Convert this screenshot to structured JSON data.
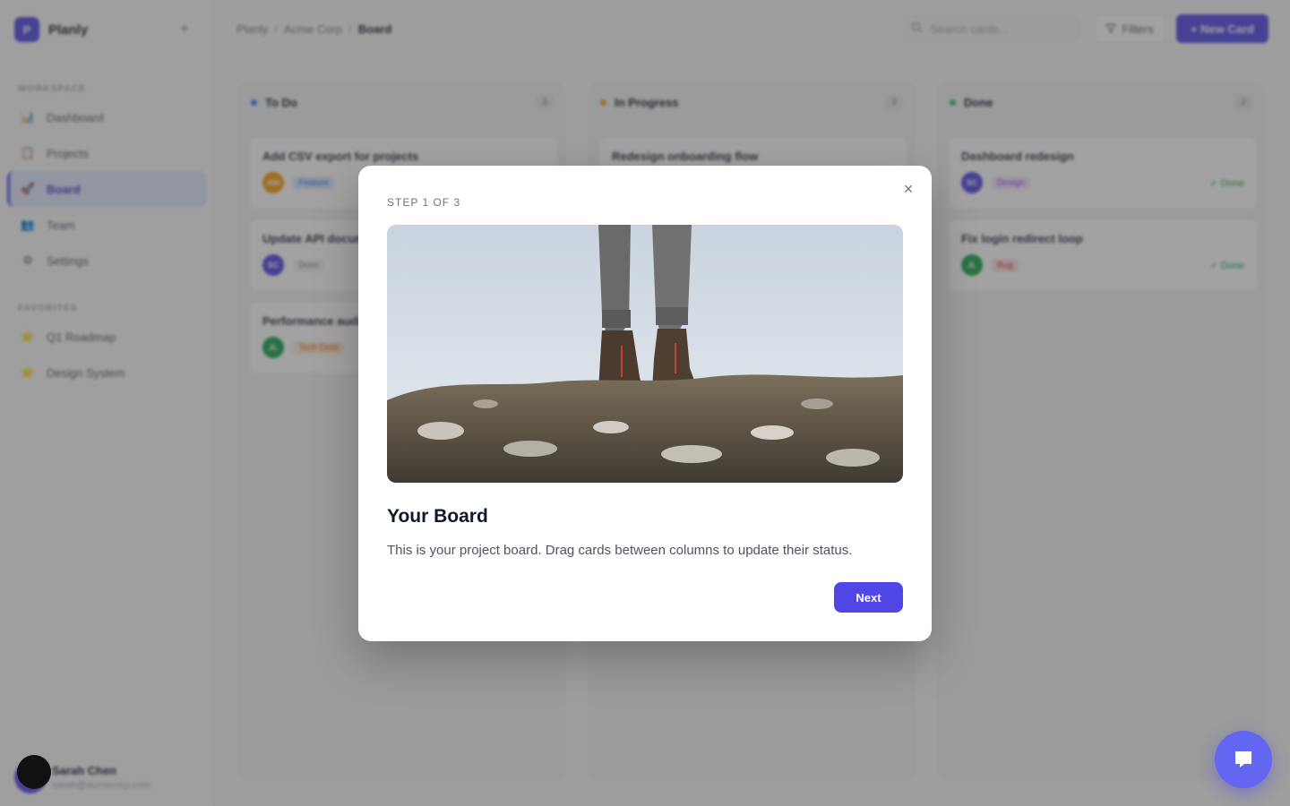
{
  "app": {
    "name": "Planly",
    "logo_letter": "P",
    "add_symbol": "+"
  },
  "sidebar": {
    "workspace_label": "WORKSPACE",
    "favorites_label": "FAVORITES",
    "items": [
      {
        "label": "Dashboard",
        "icon": "📊"
      },
      {
        "label": "Projects",
        "icon": "📋"
      },
      {
        "label": "Board",
        "icon": "🚀"
      },
      {
        "label": "Team",
        "icon": "👥"
      },
      {
        "label": "Settings",
        "icon": "⚙"
      }
    ],
    "favorites": [
      {
        "label": "Q1 Roadmap",
        "icon": "⭐"
      },
      {
        "label": "Design System",
        "icon": "⭐"
      }
    ],
    "user": {
      "name": "Sarah Chen",
      "email": "sarah@acmecorp.com",
      "initials": "SC"
    }
  },
  "header": {
    "breadcrumb": [
      "Planly",
      "Acme Corp",
      "Board"
    ],
    "separator": "/",
    "search_placeholder": "Search cards...",
    "filters_label": "Filters",
    "new_card_label": "+ New Card"
  },
  "board": {
    "columns": [
      {
        "title": "To Do",
        "count": "3",
        "color": "#3b82f6",
        "cards": [
          {
            "title": "Add CSV export for projects",
            "initials": "AM",
            "av_color": "#f59e0b",
            "tag": "Feature",
            "tag_bg": "#dbeafe",
            "tag_fg": "#2563eb",
            "status": ""
          },
          {
            "title": "Update API documentation",
            "initials": "SC",
            "av_color": "#4f46e5",
            "tag": "Docs",
            "tag_bg": "#f3f4f6",
            "tag_fg": "#6b7280",
            "status": ""
          },
          {
            "title": "Performance audit",
            "initials": "JL",
            "av_color": "#16a34a",
            "tag": "Tech Debt",
            "tag_bg": "#ffedd5",
            "tag_fg": "#ea580c",
            "status": ""
          }
        ]
      },
      {
        "title": "In Progress",
        "count": "3",
        "color": "#f59e0b",
        "cards": [
          {
            "title": "Redesign onboarding flow",
            "initials": "",
            "av_color": "",
            "tag": "",
            "tag_bg": "",
            "tag_fg": "",
            "status": ""
          }
        ]
      },
      {
        "title": "Done",
        "count": "2",
        "color": "#22c55e",
        "cards": [
          {
            "title": "Dashboard redesign",
            "initials": "SC",
            "av_color": "#4f46e5",
            "tag": "Design",
            "tag_bg": "#f3e8ff",
            "tag_fg": "#9333ea",
            "status": "✓ Done"
          },
          {
            "title": "Fix login redirect loop",
            "initials": "JL",
            "av_color": "#16a34a",
            "tag": "Bug",
            "tag_bg": "#fee2e2",
            "tag_fg": "#dc2626",
            "status": "✓ Done"
          }
        ]
      }
    ]
  },
  "modal": {
    "step": "STEP 1 OF 3",
    "title": "Your Board",
    "description": "This is your project board. Drag cards between columns to update their status.",
    "next_label": "Next",
    "close_symbol": "×"
  },
  "icons": {
    "search": "search-icon",
    "filter": "filter-icon",
    "chat": "chat-icon",
    "close": "close-icon"
  },
  "colors": {
    "accent": "#4f46e5",
    "chat": "#6366f1"
  }
}
